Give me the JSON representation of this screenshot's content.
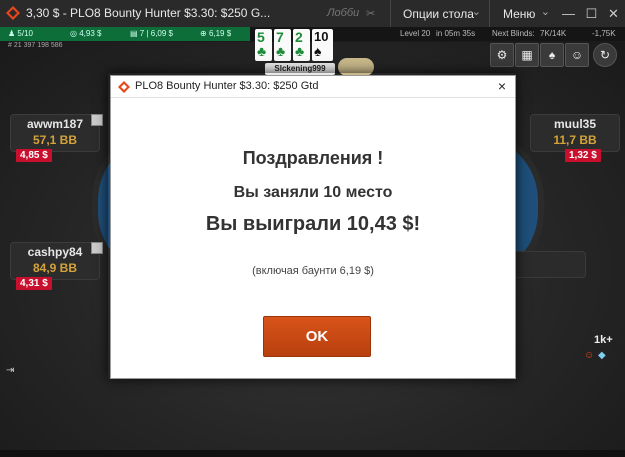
{
  "window": {
    "title": "3,30 $ - PLO8 Bounty Hunter $3.30: $250 G...",
    "lobby": "Лобби",
    "table_options": "Опции стола",
    "menu": "Меню",
    "minimize": "—",
    "maximize": "☐",
    "close": "✕"
  },
  "infobar": {
    "players": "5/10",
    "chips1": "4,93 $",
    "chips2": "7 | 6,09 $",
    "chips3": "6,19 $",
    "level": "Level 20",
    "time": "in 05m 35s",
    "next_blinds_label": "Next Blinds:",
    "next_blinds": "7K/14K",
    "delta": "-1,75K",
    "hand_id": "# 21 397 198 586"
  },
  "board": [
    {
      "rank": "5",
      "suit": "♣",
      "color": "#1e8c3a"
    },
    {
      "rank": "7",
      "suit": "♣",
      "color": "#1e8c3a"
    },
    {
      "rank": "2",
      "suit": "♣",
      "color": "#1e8c3a"
    },
    {
      "rank": "10",
      "suit": "♠",
      "color": "#111111"
    }
  ],
  "top_player": {
    "name": "Slckening999"
  },
  "players": {
    "left_top": {
      "name": "awwm187",
      "stack": "57,1 BB",
      "bounty": "4,85 $"
    },
    "right_top": {
      "name": "muul35",
      "stack": "11,7 BB",
      "bounty": "1,32 $"
    },
    "left_mid": {
      "name": "cashpy84",
      "stack": "84,9 BB",
      "bounty": "4,31 $"
    }
  },
  "right_bottom": {
    "count": "1k+"
  },
  "modal": {
    "title": "PLO8 Bounty Hunter $3.30: $250 Gtd",
    "congrats": "Поздравления !",
    "place": "Вы заняли 10 место",
    "won": "Вы выиграли 10,43 $!",
    "bounty_note": "(включая баунти 6,19 $)",
    "ok": "OK",
    "close": "×"
  },
  "colors": {
    "brand": "#e8461b",
    "ok_button": "#c9470f",
    "bounty_badge": "#c8102e",
    "stack_text": "#d4a33a"
  }
}
